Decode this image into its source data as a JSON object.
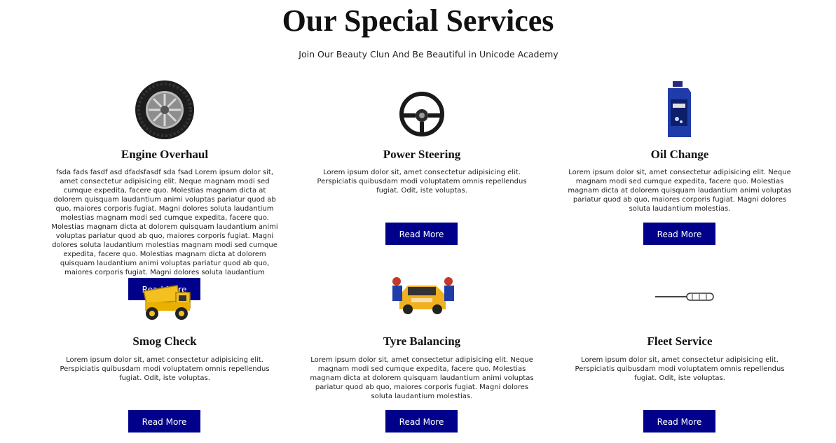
{
  "header": {
    "title": "Our Special Services",
    "subtitle": "Join Our Beauty Clun And Be Beautiful in Unicode Academy"
  },
  "cards": [
    {
      "title": "Engine Overhaul",
      "description": "fsda fads fasdf asd dfadsfasdf sda fsad Lorem ipsum dolor sit, amet consectetur adipisicing elit. Neque magnam modi sed cumque expedita, facere quo. Molestias magnam dicta at dolorem quisquam laudantium animi voluptas pariatur quod ab quo, maiores corporis fugiat. Magni dolores soluta laudantium molestias magnam modi sed cumque expedita, facere quo. Molestias magnam dicta at dolorem quisquam laudantium animi voluptas pariatur quod ab quo, maiores corporis fugiat. Magni dolores soluta laudantium molestias magnam modi sed cumque expedita, facere quo. Molestias magnam dicta at dolorem quisquam laudantium animi voluptas pariatur quod ab quo, maiores corporis fugiat. Magni dolores soluta laudantium molestias.",
      "button": "Read More",
      "icon": "tyre-icon"
    },
    {
      "title": "Power Steering",
      "description": "Lorem ipsum dolor sit, amet consectetur adipisicing elit. Perspiciatis quibusdam modi voluptatem omnis repellendus fugiat. Odit, iste voluptas.",
      "button": "Read More",
      "icon": "steering-wheel-icon"
    },
    {
      "title": "Oil Change",
      "description": "Lorem ipsum dolor sit, amet consectetur adipisicing elit. Neque magnam modi sed cumque expedita, facere quo. Molestias magnam dicta at dolorem quisquam laudantium animi voluptas pariatur quod ab quo, maiores corporis fugiat. Magni dolores soluta laudantium molestias.",
      "button": "Read More",
      "icon": "oil-bottle-icon"
    },
    {
      "title": "Smog Check",
      "description": "Lorem ipsum dolor sit, amet consectetur adipisicing elit. Perspiciatis quibusdam modi voluptatem omnis repellendus fugiat. Odit, iste voluptas.",
      "button": "Read More",
      "icon": "toy-truck-icon"
    },
    {
      "title": "Tyre Balancing",
      "description": "Lorem ipsum dolor sit, amet consectetur adipisicing elit. Neque magnam modi sed cumque expedita, facere quo. Molestias magnam dicta at dolorem quisquam laudantium animi voluptas pariatur quod ab quo, maiores corporis fugiat. Magni dolores soluta laudantium molestias.",
      "button": "Read More",
      "icon": "mechanics-car-icon"
    },
    {
      "title": "Fleet Service",
      "description": "Lorem ipsum dolor sit, amet consectetur adipisicing elit. Perspiciatis quibusdam modi voluptatem omnis repellendus fugiat. Odit, iste voluptas.",
      "button": "Read More",
      "icon": "screwdriver-icon"
    }
  ],
  "colors": {
    "button_bg": "#00008b",
    "button_text": "#ffffff"
  }
}
